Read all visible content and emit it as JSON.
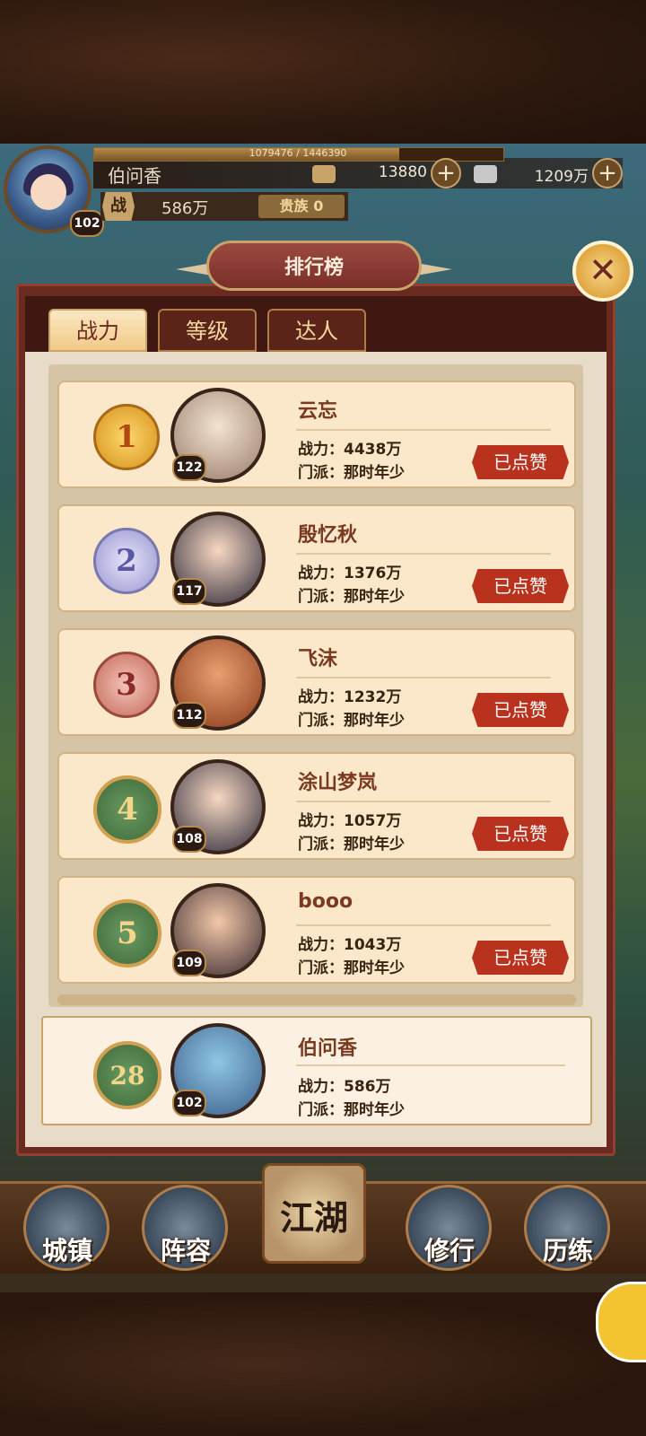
{
  "player": {
    "name": "伯问香",
    "level": "102",
    "exp_text": "1079476 / 1446390",
    "exp_ratio": 0.746,
    "gold": "13880",
    "silver": "1209万",
    "power_icon": "战",
    "power": "586万",
    "noble": "贵族 0"
  },
  "panel": {
    "title": "排行榜",
    "close_icon": "crossed-swords-icon",
    "tabs": [
      {
        "label": "战力",
        "active": true
      },
      {
        "label": "等级",
        "active": false
      },
      {
        "label": "达人",
        "active": false
      }
    ]
  },
  "ranking": [
    {
      "rank": "1",
      "level": "122",
      "name": "云忘",
      "power": "战力：4438万",
      "sect": "门派：那时年少",
      "action": "已点赞"
    },
    {
      "rank": "2",
      "level": "117",
      "name": "殷忆秋",
      "power": "战力：1376万",
      "sect": "门派：那时年少",
      "action": "已点赞"
    },
    {
      "rank": "3",
      "level": "112",
      "name": "飞沫",
      "power": "战力：1232万",
      "sect": "门派：那时年少",
      "action": "已点赞"
    },
    {
      "rank": "4",
      "level": "108",
      "name": "涂山梦岚",
      "power": "战力：1057万",
      "sect": "门派：那时年少",
      "action": "已点赞"
    },
    {
      "rank": "5",
      "level": "109",
      "name": "booo",
      "power": "战力：1043万",
      "sect": "门派：那时年少",
      "action": "已点赞"
    }
  ],
  "my_rank": {
    "rank": "28",
    "level": "102",
    "name": "伯问香",
    "power": "战力：586万",
    "sect": "门派：那时年少"
  },
  "nav": {
    "town": "城镇",
    "lineup": "阵容",
    "jianghu": "江湖",
    "cultivate": "修行",
    "training": "历练"
  },
  "colors": {
    "panel_frame": "#6b2a20",
    "card_bg": "#fbe7c9",
    "liked_button": "#b8321e",
    "gold_medal": "#e0a640",
    "silver_medal": "#a9a6d6",
    "bronze_medal": "#c46a5a",
    "plain_medal": "#4f7a4a"
  }
}
